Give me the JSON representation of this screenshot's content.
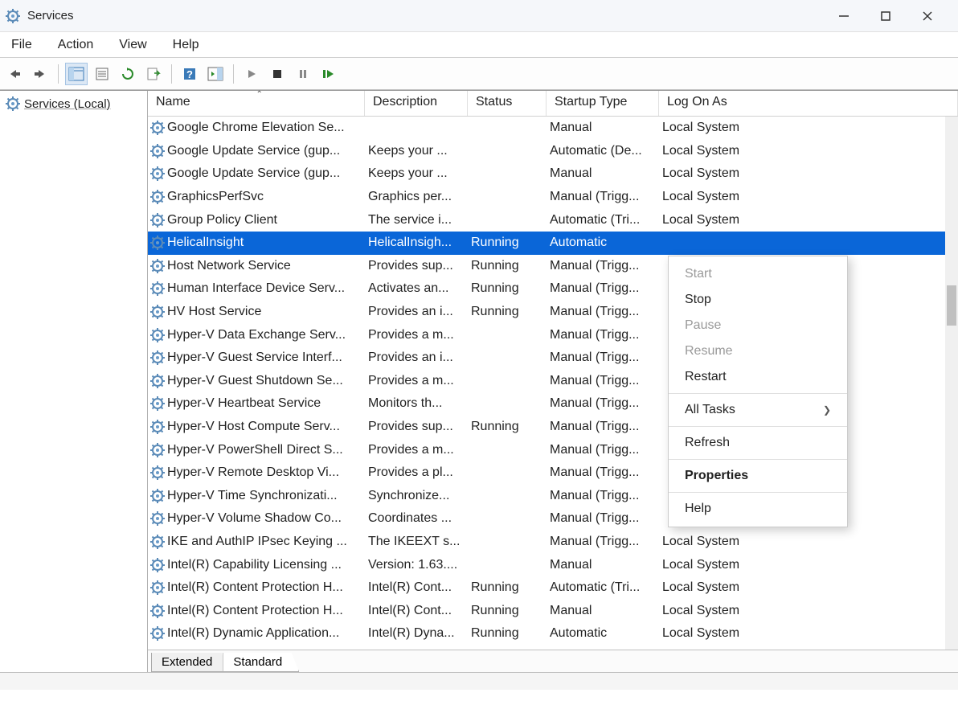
{
  "window": {
    "title": "Services"
  },
  "menu": {
    "file": "File",
    "action": "Action",
    "view": "View",
    "help": "Help"
  },
  "sidebar": {
    "label": "Services (Local)"
  },
  "columns": {
    "name": "Name",
    "description": "Description",
    "status": "Status",
    "startup": "Startup Type",
    "logon": "Log On As"
  },
  "services": [
    {
      "name": "Google Chrome Elevation Se...",
      "desc": "",
      "status": "",
      "startup": "Manual",
      "logon": "Local System",
      "selected": false
    },
    {
      "name": "Google Update Service (gup...",
      "desc": "Keeps your ...",
      "status": "",
      "startup": "Automatic (De...",
      "logon": "Local System",
      "selected": false
    },
    {
      "name": "Google Update Service (gup...",
      "desc": "Keeps your ...",
      "status": "",
      "startup": "Manual",
      "logon": "Local System",
      "selected": false
    },
    {
      "name": "GraphicsPerfSvc",
      "desc": "Graphics per...",
      "status": "",
      "startup": "Manual (Trigg...",
      "logon": "Local System",
      "selected": false
    },
    {
      "name": "Group Policy Client",
      "desc": "The service i...",
      "status": "",
      "startup": "Automatic (Tri...",
      "logon": "Local System",
      "selected": false
    },
    {
      "name": "HelicalInsight",
      "desc": "HelicalInsigh...",
      "status": "Running",
      "startup": "Automatic",
      "logon": "",
      "selected": true
    },
    {
      "name": "Host Network Service",
      "desc": "Provides sup...",
      "status": "Running",
      "startup": "Manual (Trigg...",
      "logon": "",
      "selected": false
    },
    {
      "name": "Human Interface Device Serv...",
      "desc": "Activates an...",
      "status": "Running",
      "startup": "Manual (Trigg...",
      "logon": "",
      "selected": false
    },
    {
      "name": "HV Host Service",
      "desc": "Provides an i...",
      "status": "Running",
      "startup": "Manual (Trigg...",
      "logon": "",
      "selected": false
    },
    {
      "name": "Hyper-V Data Exchange Serv...",
      "desc": "Provides a m...",
      "status": "",
      "startup": "Manual (Trigg...",
      "logon": "",
      "selected": false
    },
    {
      "name": "Hyper-V Guest Service Interf...",
      "desc": "Provides an i...",
      "status": "",
      "startup": "Manual (Trigg...",
      "logon": "",
      "selected": false
    },
    {
      "name": "Hyper-V Guest Shutdown Se...",
      "desc": "Provides a m...",
      "status": "",
      "startup": "Manual (Trigg...",
      "logon": "",
      "selected": false
    },
    {
      "name": "Hyper-V Heartbeat Service",
      "desc": "Monitors th...",
      "status": "",
      "startup": "Manual (Trigg...",
      "logon": "",
      "selected": false
    },
    {
      "name": "Hyper-V Host Compute Serv...",
      "desc": "Provides sup...",
      "status": "Running",
      "startup": "Manual (Trigg...",
      "logon": "",
      "selected": false
    },
    {
      "name": "Hyper-V PowerShell Direct S...",
      "desc": "Provides a m...",
      "status": "",
      "startup": "Manual (Trigg...",
      "logon": "",
      "selected": false
    },
    {
      "name": "Hyper-V Remote Desktop Vi...",
      "desc": "Provides a pl...",
      "status": "",
      "startup": "Manual (Trigg...",
      "logon": "",
      "selected": false
    },
    {
      "name": "Hyper-V Time Synchronizati...",
      "desc": "Synchronize...",
      "status": "",
      "startup": "Manual (Trigg...",
      "logon": "",
      "selected": false
    },
    {
      "name": "Hyper-V Volume Shadow Co...",
      "desc": "Coordinates ...",
      "status": "",
      "startup": "Manual (Trigg...",
      "logon": "",
      "selected": false
    },
    {
      "name": "IKE and AuthIP IPsec Keying ...",
      "desc": "The IKEEXT s...",
      "status": "",
      "startup": "Manual (Trigg...",
      "logon": "Local System",
      "selected": false
    },
    {
      "name": "Intel(R) Capability Licensing ...",
      "desc": "Version: 1.63....",
      "status": "",
      "startup": "Manual",
      "logon": "Local System",
      "selected": false
    },
    {
      "name": "Intel(R) Content Protection H...",
      "desc": "Intel(R) Cont...",
      "status": "Running",
      "startup": "Automatic (Tri...",
      "logon": "Local System",
      "selected": false
    },
    {
      "name": "Intel(R) Content Protection H...",
      "desc": "Intel(R) Cont...",
      "status": "Running",
      "startup": "Manual",
      "logon": "Local System",
      "selected": false
    },
    {
      "name": "Intel(R) Dynamic Application...",
      "desc": "Intel(R) Dyna...",
      "status": "Running",
      "startup": "Automatic",
      "logon": "Local System",
      "selected": false
    }
  ],
  "context_menu": {
    "start": "Start",
    "stop": "Stop",
    "pause": "Pause",
    "resume": "Resume",
    "restart": "Restart",
    "all_tasks": "All Tasks",
    "refresh": "Refresh",
    "properties": "Properties",
    "help": "Help"
  },
  "tabs": {
    "extended": "Extended",
    "standard": "Standard"
  }
}
